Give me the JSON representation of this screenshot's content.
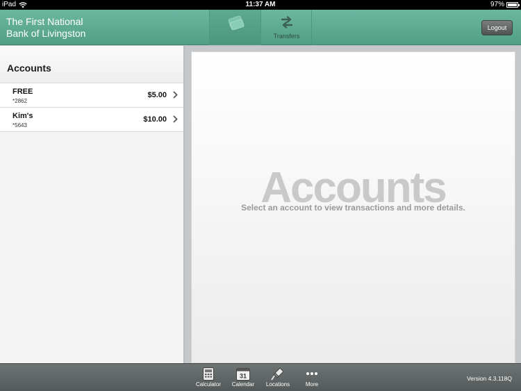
{
  "status_bar": {
    "device": "iPad",
    "time": "11:37 AM",
    "battery": "97%",
    "battery_level": 0.97
  },
  "header": {
    "bank_name_line1": "The First National",
    "bank_name_line2": "Bank of Livingston",
    "tabs": [
      {
        "label": "",
        "icon": "accounts-cards-icon",
        "active": true
      },
      {
        "label": "Transfers",
        "icon": "transfer-arrows-icon",
        "active": false
      }
    ],
    "logout_label": "Logout",
    "accent_color": "#5eab91"
  },
  "sidebar": {
    "title": "Accounts",
    "accounts": [
      {
        "name": "FREE",
        "number": "*2862",
        "balance": "$5.00"
      },
      {
        "name": "Kim's",
        "number": "*5643",
        "balance": "$10.00"
      }
    ]
  },
  "main": {
    "placeholder_title": "Accounts",
    "placeholder_subtitle": "Select an account to view transactions and more details."
  },
  "tabbar": {
    "items": [
      {
        "label": "Calculator",
        "icon": "calculator-icon"
      },
      {
        "label": "Calendar",
        "icon": "calendar-icon",
        "badge": "31"
      },
      {
        "label": "Locations",
        "icon": "map-pin-icon"
      },
      {
        "label": "More",
        "icon": "more-dots-icon"
      }
    ],
    "version": "Version 4.3.118Q"
  }
}
